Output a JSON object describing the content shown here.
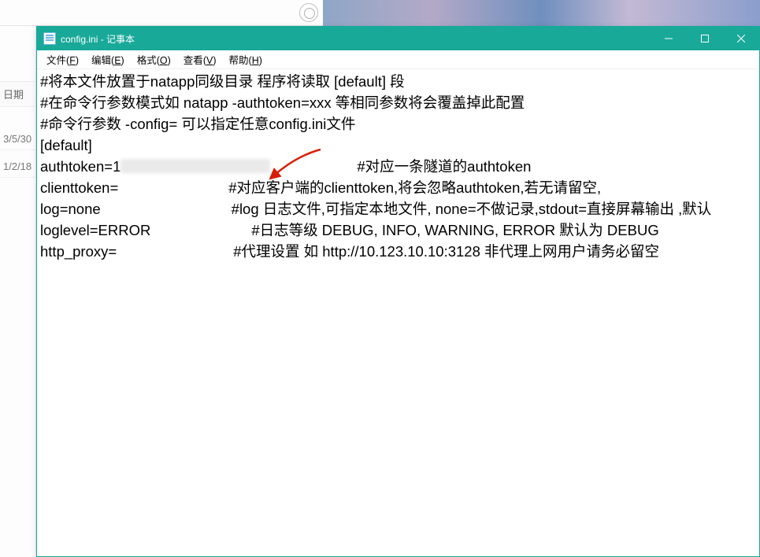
{
  "background": {
    "left_header": "日期",
    "row1": "3/5/30",
    "row2": "1/2/18"
  },
  "window": {
    "title": "config.ini - 记事本"
  },
  "menu": {
    "file": {
      "label": "文件",
      "hotkey": "F"
    },
    "edit": {
      "label": "编辑",
      "hotkey": "E"
    },
    "format": {
      "label": "格式",
      "hotkey": "O"
    },
    "view": {
      "label": "查看",
      "hotkey": "V"
    },
    "help": {
      "label": "帮助",
      "hotkey": "H"
    }
  },
  "content": {
    "l1": "#将本文件放置于natapp同级目录 程序将读取 [default] 段",
    "l2": "#在命令行参数模式如 natapp -authtoken=xxx 等相同参数将会覆盖掉此配置",
    "l3": "#命令行参数 -config= 可以指定任意config.ini文件",
    "l4": "[default]",
    "l5a": "authtoken=1",
    "l5c": "#对应一条隧道的authtoken",
    "l6a": "clienttoken=",
    "l6c": "#对应客户端的clienttoken,将会忽略authtoken,若无请留空,",
    "l7a": "log=none",
    "l7c": "#log 日志文件,可指定本地文件, none=不做记录,stdout=直接屏幕输出 ,默认",
    "l8a": "loglevel=ERROR",
    "l8c": "#日志等级 DEBUG, INFO, WARNING, ERROR 默认为 DEBUG",
    "l9a": "http_proxy=",
    "l9c": "#代理设置 如 http://10.123.10.10:3128 非代理上网用户请务必留空"
  }
}
